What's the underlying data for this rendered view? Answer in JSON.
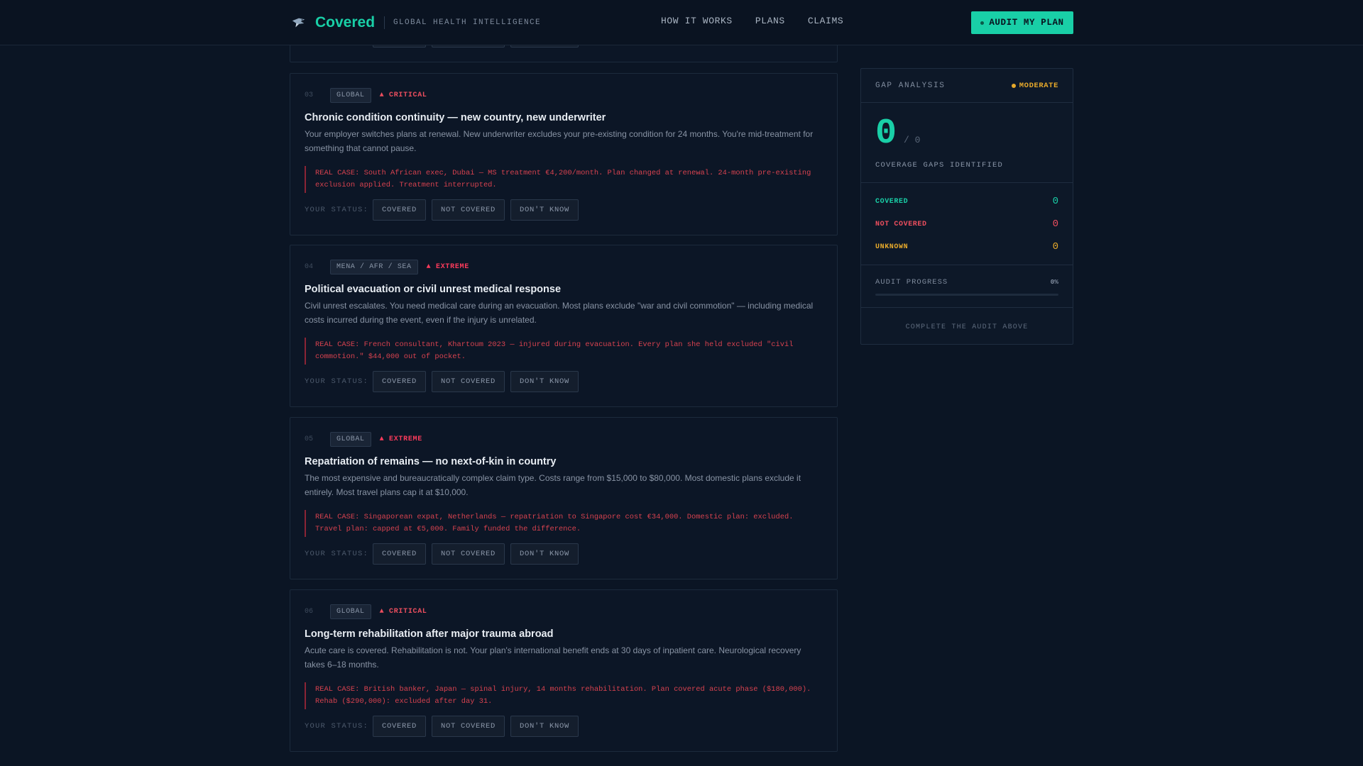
{
  "header": {
    "brand_name": "Covered",
    "tagline": "GLOBAL HEALTH INTELLIGENCE",
    "nav": [
      "HOW IT WORKS",
      "PLANS",
      "CLAIMS"
    ],
    "cta_label": "AUDIT MY PLAN"
  },
  "status_label": "YOUR STATUS:",
  "status_options": [
    "COVERED",
    "NOT COVERED",
    "DON'T KNOW"
  ],
  "cards": [
    {
      "num": "03",
      "region": "GLOBAL",
      "severity": "▲ CRITICAL",
      "title": "Chronic condition continuity — new country, new underwriter",
      "description": "Your employer switches plans at renewal. New underwriter excludes your pre-existing condition for 24 months. You're mid-treatment for something that cannot pause.",
      "real_case": "REAL CASE: South African exec, Dubai — MS treatment €4,200/month. Plan changed at renewal. 24-month pre-existing exclusion applied. Treatment interrupted."
    },
    {
      "num": "04",
      "region": "MENA / AFR / SEA",
      "severity": "▲ EXTREME",
      "title": "Political evacuation or civil unrest medical response",
      "description": "Civil unrest escalates. You need medical care during an evacuation. Most plans exclude \"war and civil commotion\" — including medical costs incurred during the event, even if the injury is unrelated.",
      "real_case": "REAL CASE: French consultant, Khartoum 2023 — injured during evacuation. Every plan she held excluded \"civil commotion.\" $44,000 out of pocket."
    },
    {
      "num": "05",
      "region": "GLOBAL",
      "severity": "▲ EXTREME",
      "title": "Repatriation of remains — no next-of-kin in country",
      "description": "The most expensive and bureaucratically complex claim type. Costs range from $15,000 to $80,000. Most domestic plans exclude it entirely. Most travel plans cap it at $10,000.",
      "real_case": "REAL CASE: Singaporean expat, Netherlands — repatriation to Singapore cost €34,000. Domestic plan: excluded. Travel plan: capped at €5,000. Family funded the difference."
    },
    {
      "num": "06",
      "region": "GLOBAL",
      "severity": "▲ CRITICAL",
      "title": "Long-term rehabilitation after major trauma abroad",
      "description": "Acute care is covered. Rehabilitation is not. Your plan's international benefit ends at 30 days of inpatient care. Neurological recovery takes 6–18 months.",
      "real_case": "REAL CASE: British banker, Japan — spinal injury, 14 months rehabilitation. Plan covered acute phase ($180,000). Rehab ($290,000): excluded after day 31."
    }
  ],
  "sidebar": {
    "title": "GAP ANALYSIS",
    "risk_level": "MODERATE",
    "score": "0",
    "score_total": "/ 0",
    "score_label": "COVERAGE GAPS IDENTIFIED",
    "stats": {
      "covered_label": "COVERED",
      "covered_value": "0",
      "not_covered_label": "NOT COVERED",
      "not_covered_value": "0",
      "unknown_label": "UNKNOWN",
      "unknown_value": "0"
    },
    "progress_label": "AUDIT PROGRESS",
    "progress_value": "0%",
    "progress_fraction": 0,
    "footer": "COMPLETE THE AUDIT ABOVE"
  },
  "colors": {
    "accent": "#19cfa7",
    "critical": "#ec4e5e",
    "warning": "#e6a92b",
    "background": "#0b1524"
  }
}
